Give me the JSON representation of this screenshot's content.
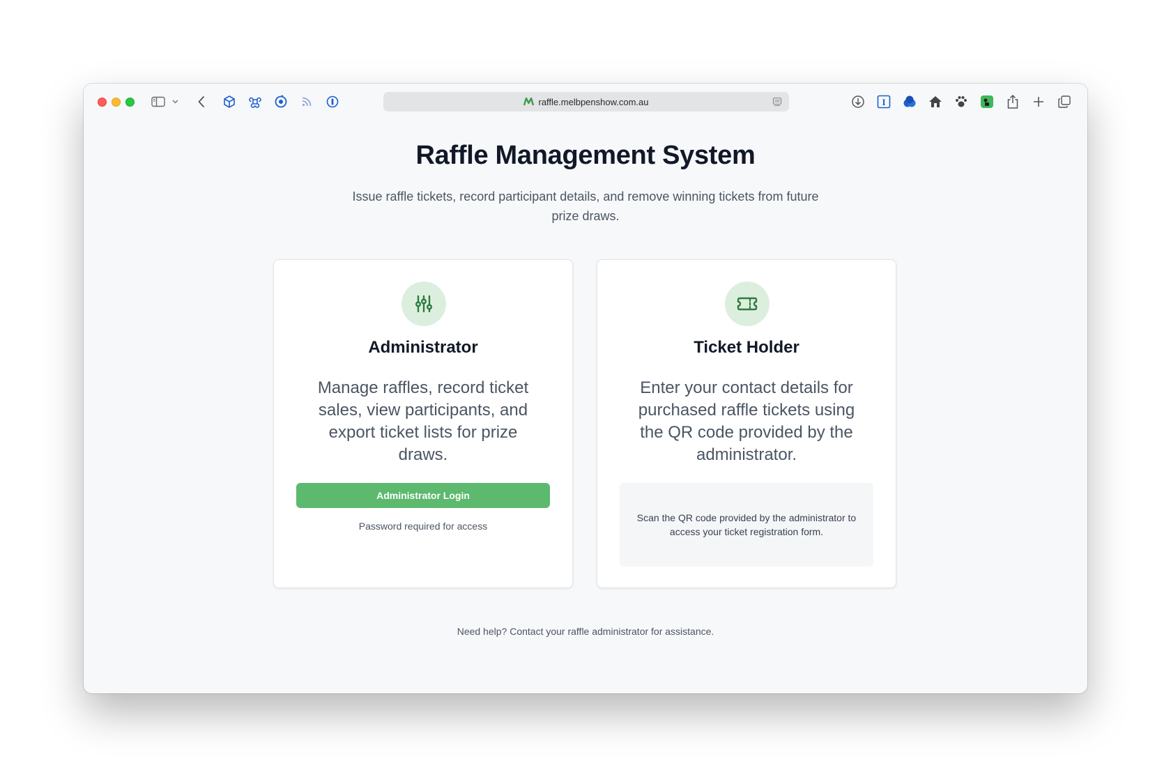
{
  "browser": {
    "url": "raffle.melbpenshow.com.au",
    "toolbar_left_icons": [
      "sidebar-icon",
      "chevron-down-icon",
      "back-icon",
      "cube-extension-icon",
      "command-extension-icon",
      "refresh-extension-icon",
      "rss-icon",
      "onepassword-icon"
    ],
    "toolbar_right_icons": [
      "download-icon",
      "instapaper-icon",
      "triple-circle-icon",
      "bird-icon",
      "paw-icon",
      "green-extension-icon",
      "share-icon",
      "new-tab-icon",
      "tabs-overview-icon"
    ]
  },
  "page": {
    "title": "Raffle Management System",
    "subtitle": "Issue raffle tickets, record participant details, and remove winning tickets from future prize draws."
  },
  "admin_card": {
    "icon": "sliders-icon",
    "title": "Administrator",
    "description": "Manage raffles, record ticket sales, view participants, and export ticket lists for prize draws.",
    "button_label": "Administrator Login",
    "note": "Password required for access"
  },
  "holder_card": {
    "icon": "ticket-icon",
    "title": "Ticket Holder",
    "description": "Enter your contact details for purchased raffle tickets using the QR code provided by the administrator.",
    "qr_instructions": "Scan the QR code provided by the administrator to access your ticket registration form."
  },
  "footer": {
    "help": "Need help? Contact your raffle administrator for assistance."
  },
  "colors": {
    "accent_green": "#5cb96e",
    "icon_circle_bg": "#dcefdf",
    "icon_green": "#2f7a3e",
    "toolbar_blue": "#1d5fd0"
  }
}
